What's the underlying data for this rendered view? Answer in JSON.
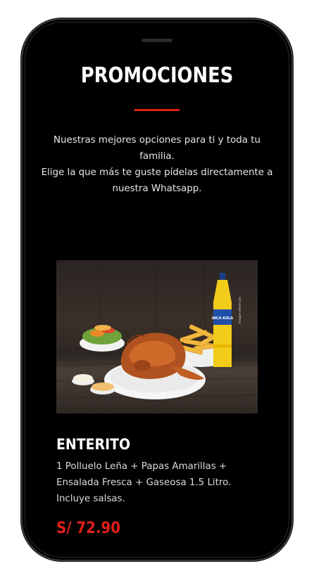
{
  "section": {
    "title": "PROMOCIONES",
    "intro_line1": "Nuestras mejores opciones para ti y toda tu familia.",
    "intro_line2": "Elige la que más te guste pídelas directamente a nuestra Whatsapp."
  },
  "promo": {
    "name": "ENTERITO",
    "description": "1 Polluelo Leña + Papas Amarillas + Ensalada Fresca + Gaseosa 1.5 Litro. Incluye salsas.",
    "price": "S/ 72.90",
    "image_caption": "Imagen referencial",
    "bottle_label": "INCA KOLA"
  },
  "colors": {
    "background": "#000000",
    "accent": "#e0201a",
    "text": "#ffffff"
  }
}
